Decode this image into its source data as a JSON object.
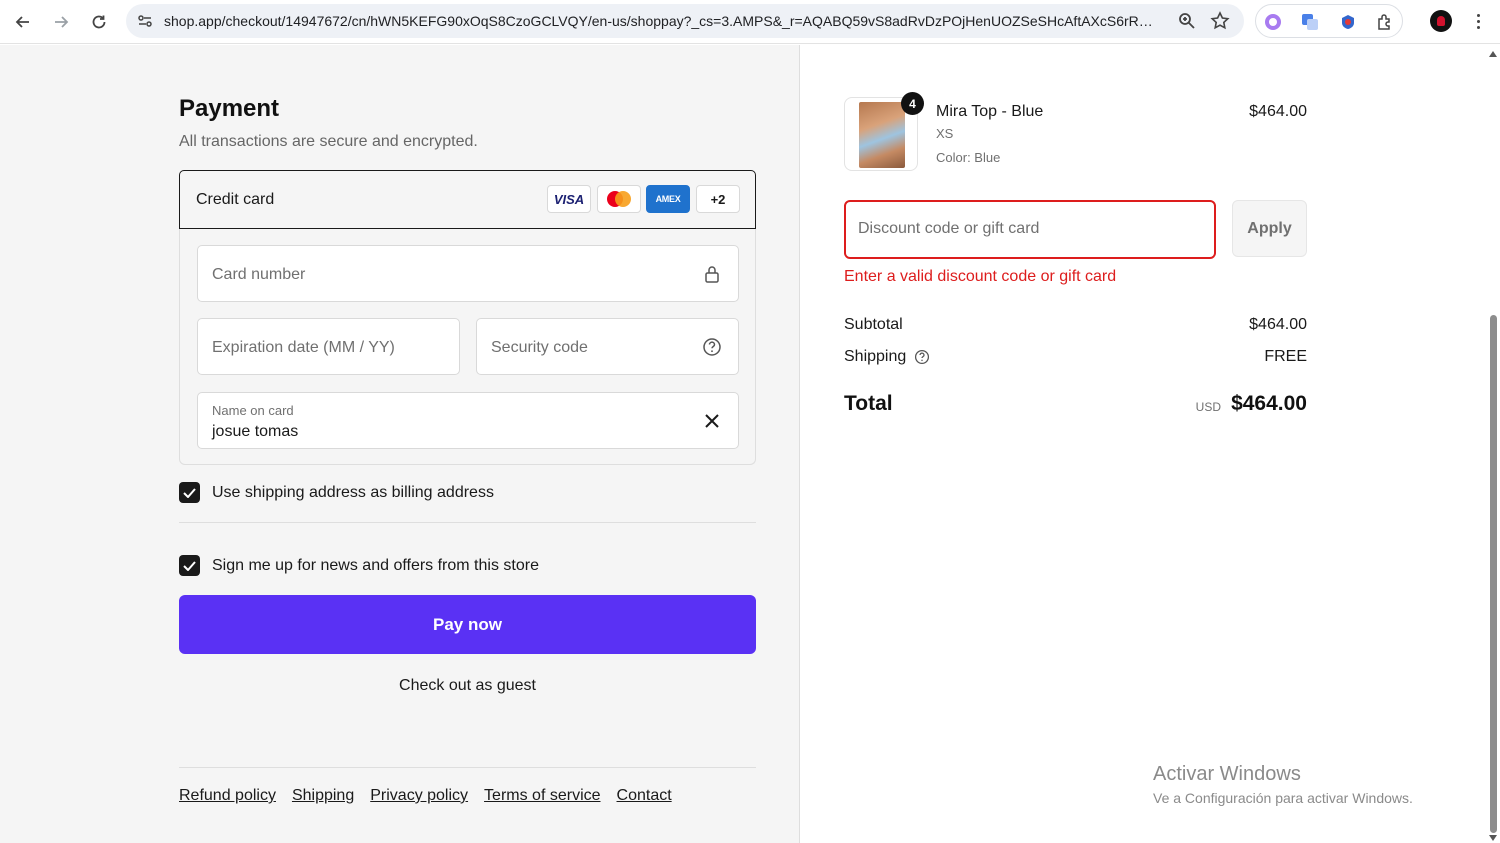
{
  "browser": {
    "url": "shop.app/checkout/14947672/cn/hWN5KEFG90xOqS8CzoGCLVQY/en-us/shoppay?_cs=3.AMPS&_r=AQABQ59vS8adRvDzPOjHenUOZSeSHcAftAXcS6rRc..."
  },
  "payment": {
    "title": "Payment",
    "subtitle": "All transactions are secure and encrypted.",
    "method_label": "Credit card",
    "brands": {
      "visa": "VISA",
      "amex": "AMEX",
      "more": "+2"
    },
    "card_number_placeholder": "Card number",
    "expiration_placeholder": "Expiration date (MM / YY)",
    "security_placeholder": "Security code",
    "name_label": "Name on card",
    "name_value": "josue tomas",
    "billing_checkbox_label": "Use shipping address as billing address",
    "billing_checked": true,
    "news_checkbox_label": "Sign me up for news and offers from this store",
    "news_checked": true,
    "pay_button": "Pay now",
    "guest_link": "Check out as guest"
  },
  "footer": {
    "links": [
      "Refund policy",
      "Shipping",
      "Privacy policy",
      "Terms of service",
      "Contact"
    ]
  },
  "order": {
    "product": {
      "name": "Mira Top - Blue",
      "size": "XS",
      "color": "Color: Blue",
      "price": "$464.00",
      "quantity": "4"
    },
    "discount_placeholder": "Discount code or gift card",
    "apply_button": "Apply",
    "discount_error": "Enter a valid discount code or gift card",
    "subtotal_label": "Subtotal",
    "subtotal_value": "$464.00",
    "shipping_label": "Shipping",
    "shipping_value": "FREE",
    "total_label": "Total",
    "total_currency": "USD",
    "total_value": "$464.00"
  },
  "os_watermark": {
    "line1": "Activar Windows",
    "line2": "Ve a Configuración para activar Windows."
  },
  "colors": {
    "accent": "#5a31f4",
    "error": "#dd1d1d"
  }
}
